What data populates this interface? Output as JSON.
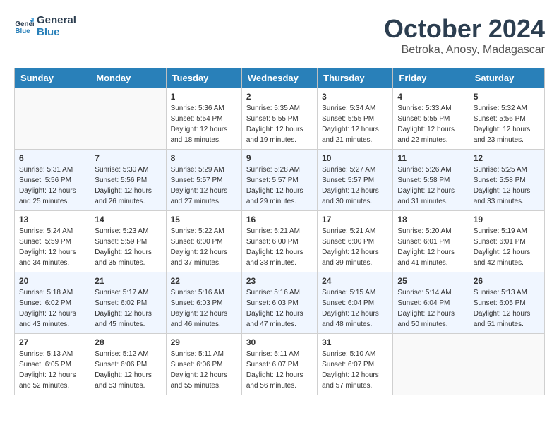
{
  "header": {
    "logo_line1": "General",
    "logo_line2": "Blue",
    "month": "October 2024",
    "location": "Betroka, Anosy, Madagascar"
  },
  "days_of_week": [
    "Sunday",
    "Monday",
    "Tuesday",
    "Wednesday",
    "Thursday",
    "Friday",
    "Saturday"
  ],
  "weeks": [
    [
      {
        "num": "",
        "sunrise": "",
        "sunset": "",
        "daylight": ""
      },
      {
        "num": "",
        "sunrise": "",
        "sunset": "",
        "daylight": ""
      },
      {
        "num": "1",
        "sunrise": "Sunrise: 5:36 AM",
        "sunset": "Sunset: 5:54 PM",
        "daylight": "Daylight: 12 hours and 18 minutes."
      },
      {
        "num": "2",
        "sunrise": "Sunrise: 5:35 AM",
        "sunset": "Sunset: 5:55 PM",
        "daylight": "Daylight: 12 hours and 19 minutes."
      },
      {
        "num": "3",
        "sunrise": "Sunrise: 5:34 AM",
        "sunset": "Sunset: 5:55 PM",
        "daylight": "Daylight: 12 hours and 21 minutes."
      },
      {
        "num": "4",
        "sunrise": "Sunrise: 5:33 AM",
        "sunset": "Sunset: 5:55 PM",
        "daylight": "Daylight: 12 hours and 22 minutes."
      },
      {
        "num": "5",
        "sunrise": "Sunrise: 5:32 AM",
        "sunset": "Sunset: 5:56 PM",
        "daylight": "Daylight: 12 hours and 23 minutes."
      }
    ],
    [
      {
        "num": "6",
        "sunrise": "Sunrise: 5:31 AM",
        "sunset": "Sunset: 5:56 PM",
        "daylight": "Daylight: 12 hours and 25 minutes."
      },
      {
        "num": "7",
        "sunrise": "Sunrise: 5:30 AM",
        "sunset": "Sunset: 5:56 PM",
        "daylight": "Daylight: 12 hours and 26 minutes."
      },
      {
        "num": "8",
        "sunrise": "Sunrise: 5:29 AM",
        "sunset": "Sunset: 5:57 PM",
        "daylight": "Daylight: 12 hours and 27 minutes."
      },
      {
        "num": "9",
        "sunrise": "Sunrise: 5:28 AM",
        "sunset": "Sunset: 5:57 PM",
        "daylight": "Daylight: 12 hours and 29 minutes."
      },
      {
        "num": "10",
        "sunrise": "Sunrise: 5:27 AM",
        "sunset": "Sunset: 5:57 PM",
        "daylight": "Daylight: 12 hours and 30 minutes."
      },
      {
        "num": "11",
        "sunrise": "Sunrise: 5:26 AM",
        "sunset": "Sunset: 5:58 PM",
        "daylight": "Daylight: 12 hours and 31 minutes."
      },
      {
        "num": "12",
        "sunrise": "Sunrise: 5:25 AM",
        "sunset": "Sunset: 5:58 PM",
        "daylight": "Daylight: 12 hours and 33 minutes."
      }
    ],
    [
      {
        "num": "13",
        "sunrise": "Sunrise: 5:24 AM",
        "sunset": "Sunset: 5:59 PM",
        "daylight": "Daylight: 12 hours and 34 minutes."
      },
      {
        "num": "14",
        "sunrise": "Sunrise: 5:23 AM",
        "sunset": "Sunset: 5:59 PM",
        "daylight": "Daylight: 12 hours and 35 minutes."
      },
      {
        "num": "15",
        "sunrise": "Sunrise: 5:22 AM",
        "sunset": "Sunset: 6:00 PM",
        "daylight": "Daylight: 12 hours and 37 minutes."
      },
      {
        "num": "16",
        "sunrise": "Sunrise: 5:21 AM",
        "sunset": "Sunset: 6:00 PM",
        "daylight": "Daylight: 12 hours and 38 minutes."
      },
      {
        "num": "17",
        "sunrise": "Sunrise: 5:21 AM",
        "sunset": "Sunset: 6:00 PM",
        "daylight": "Daylight: 12 hours and 39 minutes."
      },
      {
        "num": "18",
        "sunrise": "Sunrise: 5:20 AM",
        "sunset": "Sunset: 6:01 PM",
        "daylight": "Daylight: 12 hours and 41 minutes."
      },
      {
        "num": "19",
        "sunrise": "Sunrise: 5:19 AM",
        "sunset": "Sunset: 6:01 PM",
        "daylight": "Daylight: 12 hours and 42 minutes."
      }
    ],
    [
      {
        "num": "20",
        "sunrise": "Sunrise: 5:18 AM",
        "sunset": "Sunset: 6:02 PM",
        "daylight": "Daylight: 12 hours and 43 minutes."
      },
      {
        "num": "21",
        "sunrise": "Sunrise: 5:17 AM",
        "sunset": "Sunset: 6:02 PM",
        "daylight": "Daylight: 12 hours and 45 minutes."
      },
      {
        "num": "22",
        "sunrise": "Sunrise: 5:16 AM",
        "sunset": "Sunset: 6:03 PM",
        "daylight": "Daylight: 12 hours and 46 minutes."
      },
      {
        "num": "23",
        "sunrise": "Sunrise: 5:16 AM",
        "sunset": "Sunset: 6:03 PM",
        "daylight": "Daylight: 12 hours and 47 minutes."
      },
      {
        "num": "24",
        "sunrise": "Sunrise: 5:15 AM",
        "sunset": "Sunset: 6:04 PM",
        "daylight": "Daylight: 12 hours and 48 minutes."
      },
      {
        "num": "25",
        "sunrise": "Sunrise: 5:14 AM",
        "sunset": "Sunset: 6:04 PM",
        "daylight": "Daylight: 12 hours and 50 minutes."
      },
      {
        "num": "26",
        "sunrise": "Sunrise: 5:13 AM",
        "sunset": "Sunset: 6:05 PM",
        "daylight": "Daylight: 12 hours and 51 minutes."
      }
    ],
    [
      {
        "num": "27",
        "sunrise": "Sunrise: 5:13 AM",
        "sunset": "Sunset: 6:05 PM",
        "daylight": "Daylight: 12 hours and 52 minutes."
      },
      {
        "num": "28",
        "sunrise": "Sunrise: 5:12 AM",
        "sunset": "Sunset: 6:06 PM",
        "daylight": "Daylight: 12 hours and 53 minutes."
      },
      {
        "num": "29",
        "sunrise": "Sunrise: 5:11 AM",
        "sunset": "Sunset: 6:06 PM",
        "daylight": "Daylight: 12 hours and 55 minutes."
      },
      {
        "num": "30",
        "sunrise": "Sunrise: 5:11 AM",
        "sunset": "Sunset: 6:07 PM",
        "daylight": "Daylight: 12 hours and 56 minutes."
      },
      {
        "num": "31",
        "sunrise": "Sunrise: 5:10 AM",
        "sunset": "Sunset: 6:07 PM",
        "daylight": "Daylight: 12 hours and 57 minutes."
      },
      {
        "num": "",
        "sunrise": "",
        "sunset": "",
        "daylight": ""
      },
      {
        "num": "",
        "sunrise": "",
        "sunset": "",
        "daylight": ""
      }
    ]
  ]
}
